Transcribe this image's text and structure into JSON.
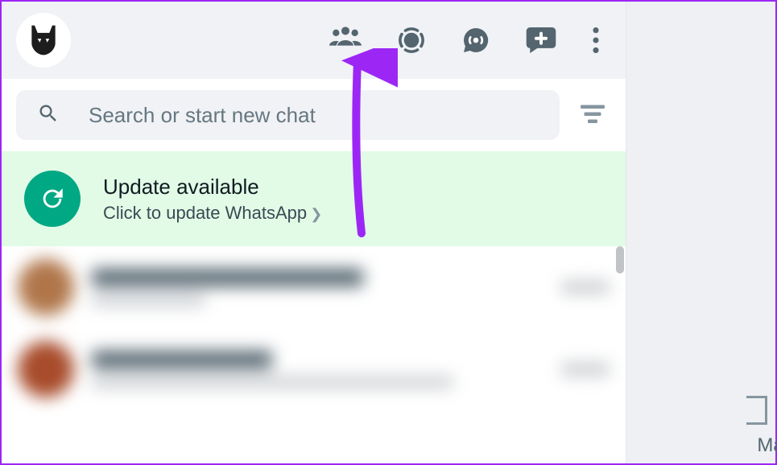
{
  "header": {
    "avatar_name": "profile-avatar"
  },
  "icons": {
    "communities": "Communities",
    "status": "Status",
    "channels": "Channels",
    "newchat": "New chat",
    "menu": "Menu"
  },
  "search": {
    "placeholder": "Search or start new chat"
  },
  "update": {
    "title": "Update available",
    "subtitle": "Click to update WhatsApp"
  },
  "right_label": "Make"
}
